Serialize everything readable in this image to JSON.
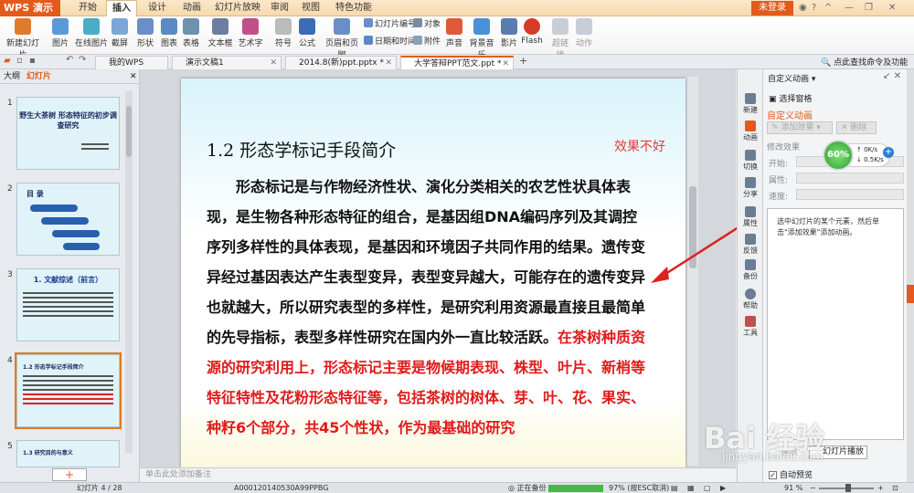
{
  "titlebar": {
    "app_name": "WPS 演示",
    "tabs": [
      "开始",
      "插入",
      "设计",
      "动画",
      "幻灯片放映",
      "审阅",
      "视图",
      "特色功能"
    ],
    "active_tab": "插入",
    "login": "未登录"
  },
  "ribbon": {
    "groups": [
      {
        "label": "新建幻灯片",
        "color": "#e07b2c"
      },
      {
        "label": "图片",
        "color": "#5b9bd5"
      },
      {
        "label": "在线图片",
        "color": "#4bacc6"
      },
      {
        "label": "截屏",
        "color": "#7aa6d8"
      },
      {
        "label": "形状",
        "color": "#6a8fc8"
      },
      {
        "label": "图表",
        "color": "#5a8ac6"
      },
      {
        "label": "表格",
        "color": "#7090b0"
      },
      {
        "label": "文本框",
        "color": "#6c7fa0"
      },
      {
        "label": "艺术字",
        "color": "#c24f8a"
      },
      {
        "label": "符号",
        "color": "#999999"
      },
      {
        "label": "公式",
        "color": "#3b6db6"
      },
      {
        "label": "页眉和页脚",
        "color": "#6a8fc8"
      },
      {
        "label": "声音",
        "color": "#e05a3a"
      },
      {
        "label": "背景音乐",
        "color": "#4a90d9"
      },
      {
        "label": "影片",
        "color": "#5a7db0"
      },
      {
        "label": "Flash",
        "color": "#d83a2a"
      },
      {
        "label": "超链接",
        "color": "#9aa8b8"
      },
      {
        "label": "动作",
        "color": "#8a9cb0"
      }
    ],
    "small": {
      "slide_number": "幻灯片编号",
      "object": "对象",
      "datetime": "日期和时间",
      "attachment": "附件"
    }
  },
  "quick_access": {
    "search_label": "点此查找命令及功能"
  },
  "doc_tabs": [
    {
      "label": "我的WPS",
      "active": false
    },
    {
      "label": "演示文稿1",
      "active": false
    },
    {
      "label": "2014.8(新)ppt.pptx *",
      "active": false
    },
    {
      "label": "大学答辩PPT范文.ppt *",
      "active": true
    }
  ],
  "left_panel": {
    "tab_outline": "大纲",
    "tab_slides": "幻灯片",
    "thumbs": [
      {
        "num": "1",
        "title": "野生大茶树 形态特征的初步调查研究"
      },
      {
        "num": "2",
        "title": "目 录"
      },
      {
        "num": "3",
        "title": "1. 文献综述（前言）"
      },
      {
        "num": "4",
        "title": "1.2 形态学标记手段简介"
      },
      {
        "num": "5",
        "title": "1.3 研究目的与意义"
      }
    ],
    "add_button": "+"
  },
  "slide": {
    "title": "1.2 形态学标记手段简介",
    "note": "效果不好",
    "para_black": "形态标记是与作物经济性状、演化分类相关的农艺性状具体表现，是生物各种形态特征的组合，是基因组DNA编码序列及其调控序列多样性的具体表现，是基因和环境因子共同作用的结果。遗传变异经过基因表达产生表型变异，表型变异越大，可能存在的遗传变异也就越大，所以研究表型的多样性，是研究利用资源最直接且最简单的先导指标，表型多样性研究在国内外一直比较活跃。",
    "para_red": "在茶树种质资源的研究利用上，形态标记主要是物候期表现、株型、叶片、新梢等特征特性及花粉形态特征等，包括茶树的树体、芽、叶、花、果实、种籽6个部分，共45个性状，作为最基础的研究"
  },
  "notes_placeholder": "单击此处添加备注",
  "side_strip": [
    "新建",
    "动画",
    "切换",
    "分享",
    "属性",
    "反馈",
    "备份",
    "帮助",
    "工具"
  ],
  "anim_pane": {
    "title": "自定义动画",
    "select_pane": "选择窗格",
    "custom_header": "自定义动画",
    "add_effect": "添加效果",
    "delete": "删除",
    "modify_header": "修改效果",
    "start": "开始:",
    "property": "属性:",
    "speed": "速度:",
    "hint": "选中幻灯片的某个元素，然后单击\"添加效果\"添加动画。",
    "play": "播放",
    "slideshow": "幻灯片播放",
    "autopreview": "自动预览"
  },
  "speed_widget": {
    "percent": "60%",
    "up": "0K/s",
    "down": "0.5K/s"
  },
  "status": {
    "slide_counter": "幻灯片 4 / 28",
    "template": "A000120140530A99PPBG",
    "backup": "正在备份",
    "progress_text": "97% (按ESC取消)",
    "zoom": "91 %"
  },
  "watermark": {
    "text": "Bai 经验",
    "url": "jingyan.baidu.com"
  },
  "colors": {
    "accent": "#e25a1c",
    "red_text": "#e01b1b",
    "arrow": "#e02020"
  }
}
